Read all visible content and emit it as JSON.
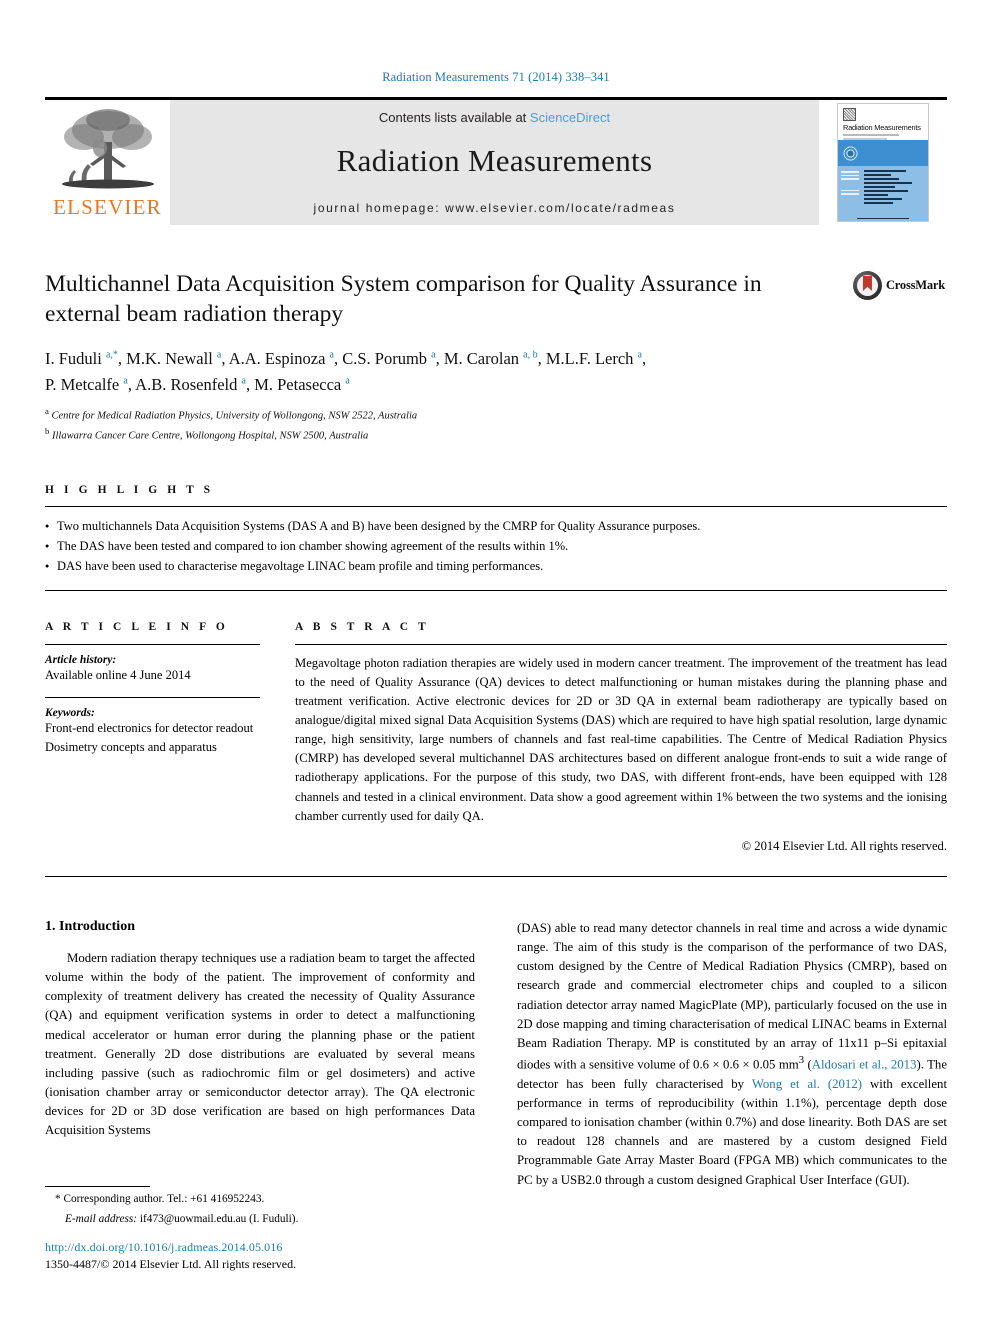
{
  "running_head": "Radiation Measurements 71 (2014) 338–341",
  "banner": {
    "publisher_name": "ELSEVIER",
    "contents_prefix": "Contents lists available at ",
    "sciencedirect": "ScienceDirect",
    "journal_title": "Radiation Measurements",
    "homepage": "journal homepage: www.elsevier.com/locate/radmeas",
    "cover_title": "Radiation Measurements"
  },
  "article": {
    "title": "Multichannel Data Acquisition System comparison for Quality Assurance in external beam radiation therapy",
    "crossmark_label": "CrossMark",
    "authors_line1": "I. Fuduli a,*, M.K. Newall a, A.A. Espinoza a, C.S. Porumb a, M. Carolan a, b, M.L.F. Lerch a,",
    "authors_line2": "P. Metcalfe a, A.B. Rosenfeld a, M. Petasecca a",
    "affiliation_a": "Centre for Medical Radiation Physics, University of Wollongong, NSW 2522, Australia",
    "affiliation_b": "Illawarra Cancer Care Centre, Wollongong Hospital, NSW 2500, Australia"
  },
  "highlights": {
    "heading": "H I G H L I G H T S",
    "items": [
      "Two multichannels Data Acquisition Systems (DAS A and B) have been designed by the CMRP for Quality Assurance purposes.",
      "The DAS have been tested and compared to ion chamber showing agreement of the results within 1%.",
      "DAS have been used to characterise megavoltage LINAC beam profile and timing performances."
    ]
  },
  "article_info": {
    "heading": "A R T I C L E   I N F O",
    "history_label": "Article history:",
    "history_value": "Available online 4 June 2014",
    "keywords_label": "Keywords:",
    "keywords": [
      "Front-end electronics for detector readout",
      "Dosimetry concepts and apparatus"
    ]
  },
  "abstract": {
    "heading": "A B S T R A C T",
    "text": "Megavoltage photon radiation therapies are widely used in modern cancer treatment. The improvement of the treatment has lead to the need of Quality Assurance (QA) devices to detect malfunctioning or human mistakes during the planning phase and treatment verification. Active electronic devices for 2D or 3D QA in external beam radiotherapy are typically based on analogue/digital mixed signal Data Acquisition Systems (DAS) which are required to have high spatial resolution, large dynamic range, high sensitivity, large numbers of channels and fast real-time capabilities. The Centre of Medical Radiation Physics (CMRP) has developed several multichannel DAS architectures based on different analogue front-ends to suit a wide range of radiotherapy applications. For the purpose of this study, two DAS, with different front-ends, have been equipped with 128 channels and tested in a clinical environment. Data show a good agreement within 1% between the two systems and the ionising chamber currently used for daily QA.",
    "copyright": "© 2014 Elsevier Ltd. All rights reserved."
  },
  "introduction": {
    "section_number_title": "1. Introduction",
    "left_paragraph": "Modern radiation therapy techniques use a radiation beam to target the affected volume within the body of the patient. The improvement of conformity and complexity of treatment delivery has created the necessity of Quality Assurance (QA) and equipment verification systems in order to detect a malfunctioning medical accelerator or human error during the planning phase or the patient treatment. Generally 2D dose distributions are evaluated by several means including passive (such as radiochromic film or gel dosimeters) and active (ionisation chamber array or semiconductor detector array). The QA electronic devices for 2D or 3D dose verification are based on high performances Data Acquisition Systems",
    "right_part1": "(DAS) able to read many detector channels in real time and across a wide dynamic range. The aim of this study is the comparison of the performance of two DAS, custom designed by the Centre of Medical Radiation Physics (CMRP), based on research grade and commercial electrometer chips and coupled to a silicon radiation detector array named MagicPlate (MP), particularly focused on the use in 2D dose mapping and timing characterisation of medical LINAC beams in External Beam Radiation Therapy. MP is constituted by an array of 11x11 p–Si epitaxial diodes with a sensitive volume of 0.6 × 0.6 × 0.05 mm",
    "right_sup": "3",
    "right_part2": " (",
    "citation1": "Aldosari et al., 2013",
    "right_part3": "). The detector has been fully characterised by ",
    "citation2": "Wong et al. (2012)",
    "right_part4": " with excellent performance in terms of reproducibility (within 1.1%), percentage depth dose compared to ionisation chamber (within 0.7%) and dose linearity. Both DAS are set to readout 128 channels and are mastered by a custom designed Field Programmable Gate Array Master Board (FPGA MB) which communicates to the PC by a USB2.0 through a custom designed Graphical User Interface (GUI)."
  },
  "footnote": {
    "corresponding": "* Corresponding author. Tel.: +61 416952243.",
    "email_label": "E-mail address:",
    "email": "if473@uowmail.edu.au",
    "email_owner": "(I. Fuduli)."
  },
  "footer": {
    "doi": "http://dx.doi.org/10.1016/j.radmeas.2014.05.016",
    "issn_line": "1350-4487/© 2014 Elsevier Ltd. All rights reserved."
  },
  "colors": {
    "link_blue": "#1a7bb0",
    "sciencedirect_blue": "#4a9fd5",
    "elsevier_orange": "#e87722",
    "banner_gray": "#e6e6e6"
  }
}
